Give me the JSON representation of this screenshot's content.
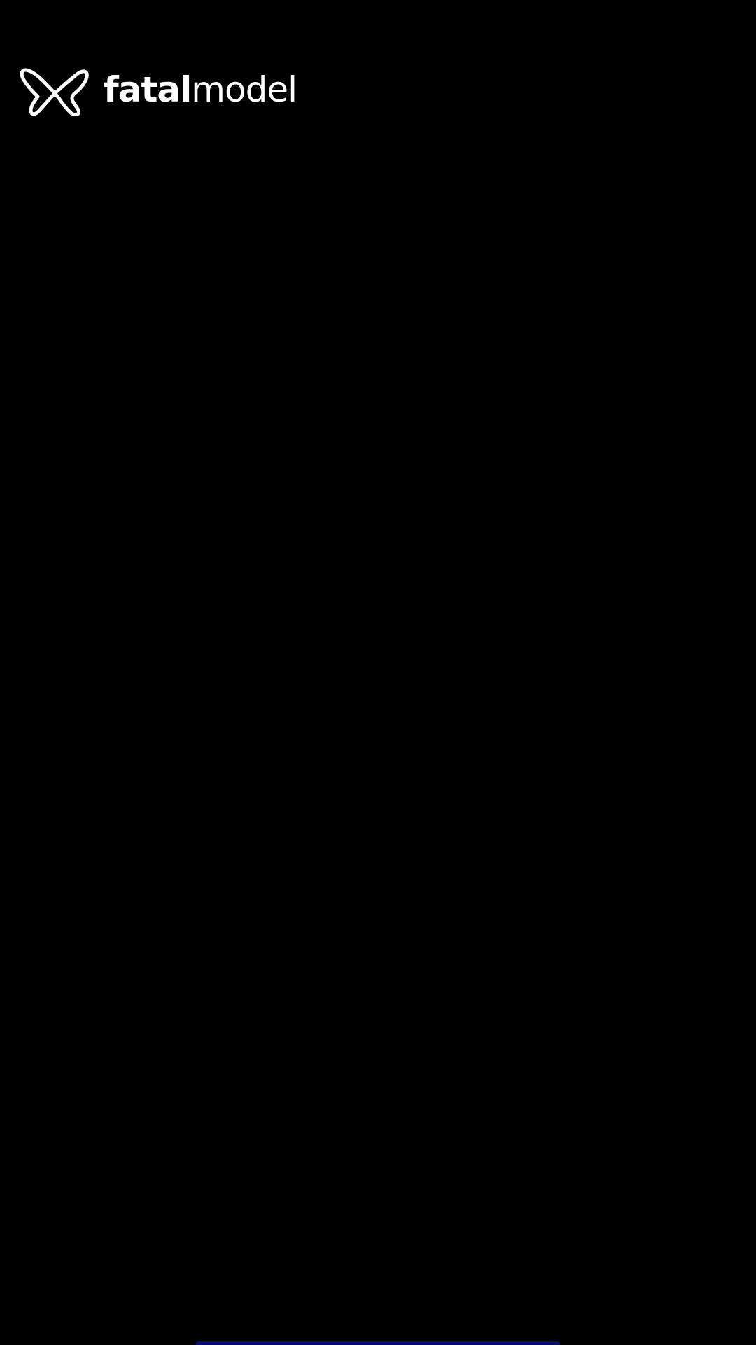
{
  "header": {
    "logo_icon": "butterfly-logo-icon",
    "brand_part1": "fatal",
    "brand_part2": "model"
  },
  "colors": {
    "background": "#000000",
    "logo": "#ffffff",
    "indicator": "#0a0a78"
  }
}
